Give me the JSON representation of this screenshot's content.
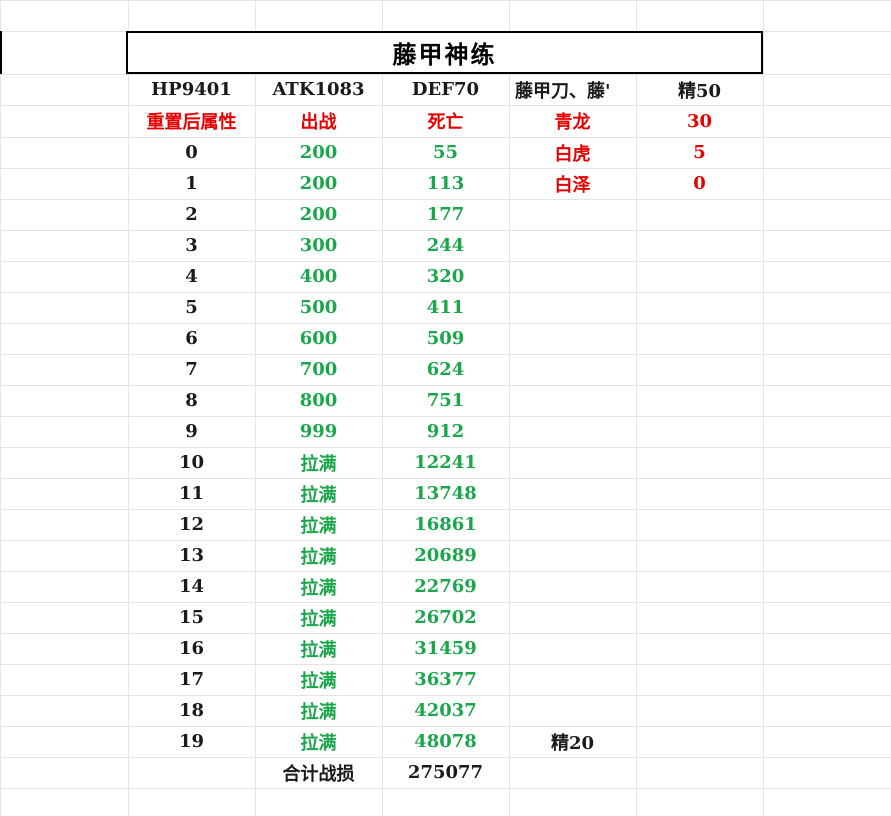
{
  "sheet": {
    "title": "藤甲神练",
    "header_row": [
      "HP9401",
      "ATK1083",
      "DEF70",
      "藤甲刀、藤'",
      "精50"
    ],
    "label_row": [
      "重置后属性",
      "出战",
      "死亡",
      "青龙",
      "30"
    ],
    "extra_rows": [
      [
        "白虎",
        "5"
      ],
      [
        "白泽",
        "0"
      ]
    ],
    "rows": [
      [
        "0",
        "200",
        "55"
      ],
      [
        "1",
        "200",
        "113"
      ],
      [
        "2",
        "200",
        "177"
      ],
      [
        "3",
        "300",
        "244"
      ],
      [
        "4",
        "400",
        "320"
      ],
      [
        "5",
        "500",
        "411"
      ],
      [
        "6",
        "600",
        "509"
      ],
      [
        "7",
        "700",
        "624"
      ],
      [
        "8",
        "800",
        "751"
      ],
      [
        "9",
        "999",
        "912"
      ],
      [
        "10",
        "拉满",
        "12241"
      ],
      [
        "11",
        "拉满",
        "13748"
      ],
      [
        "12",
        "拉满",
        "16861"
      ],
      [
        "13",
        "拉满",
        "20689"
      ],
      [
        "14",
        "拉满",
        "22769"
      ],
      [
        "15",
        "拉满",
        "26702"
      ],
      [
        "16",
        "拉满",
        "31459"
      ],
      [
        "17",
        "拉满",
        "36377"
      ],
      [
        "18",
        "拉满",
        "42037"
      ],
      [
        "19",
        "拉满",
        "48078"
      ]
    ],
    "row19_note": "精20",
    "total_label": "合计战损",
    "total_value": "275077",
    "colors": {
      "red": "#e60000",
      "green": "#1aa64a",
      "text": "#1a1a1a",
      "grid": "#e3e3e3"
    }
  }
}
